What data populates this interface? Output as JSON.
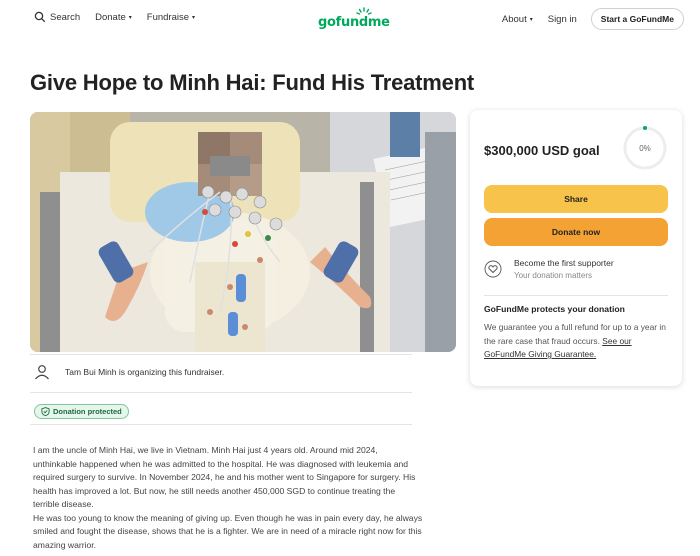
{
  "header": {
    "search_label": "Search",
    "donate_label": "Donate",
    "fundraise_label": "Fundraise",
    "logo_text": "gofundme",
    "about_label": "About",
    "signin_label": "Sign in",
    "start_label": "Start a GoFundMe",
    "brand_color": "#02a95c"
  },
  "campaign": {
    "title": "Give Hope to Minh Hai: Fund His Treatment",
    "organizer": "Tam Bui Minh is organizing this fundraiser.",
    "badge": "Donation protected",
    "story": [
      "I am the uncle of Minh Hai, we live in Vietnam. Minh Hai just 4 years old. Around mid 2024, unthinkable happened when he was admitted to the hospital. He was diagnosed with leukemia and required surgery to survive. In November 2024, he and his mother went to Singapore for surgery. His health has improved a lot. But now, he still needs another 450,000 SGD to continue treating the terrible disease.",
      "He was too young to know the meaning of giving up. Even though he was in pain every day, he always smiled and fought the disease, shows that he is a fighter. We are in need of a miracle right now for this amazing warrior."
    ]
  },
  "sidebar": {
    "goal": "$300,000 USD goal",
    "progress_label": "0%",
    "progress": 0,
    "share_label": "Share",
    "donate_label": "Donate now",
    "supporter_title": "Become the first supporter",
    "supporter_sub": "Your donation matters",
    "protect_title": "GoFundMe protects your donation",
    "protect_text": "We guarantee you a full refund for up to a year in the rare case that fraud occurs.",
    "protect_link": "See our GoFundMe Giving Guarantee.",
    "share_color": "#f7c34a",
    "donate_color": "#f4a233"
  }
}
